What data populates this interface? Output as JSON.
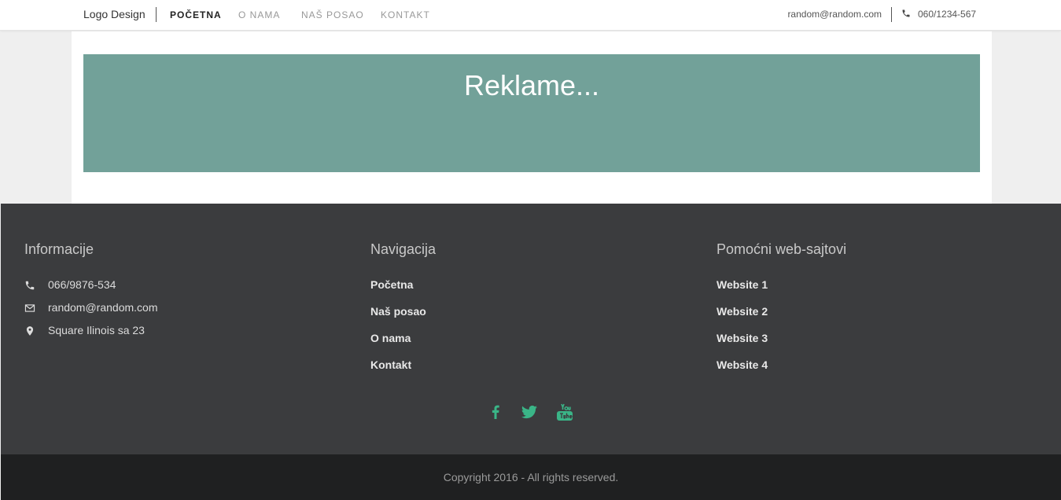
{
  "header": {
    "logo": "Logo Design",
    "nav": [
      {
        "label": "POČETNA"
      },
      {
        "label": "O NAMA"
      },
      {
        "label": "NAŠ POSAO"
      },
      {
        "label": "KONTAKT"
      }
    ],
    "email": "random@random.com",
    "phone": "060/1234-567"
  },
  "banner": {
    "title": "Reklame..."
  },
  "footer": {
    "info": {
      "title": "Informacije",
      "phone": "066/9876-534",
      "email": "random@random.com",
      "address": "Square Ilinois sa 23"
    },
    "navigation": {
      "title": "Navigacija",
      "links": [
        "Početna",
        "Naš posao",
        "O nama",
        "Kontakt"
      ]
    },
    "websites": {
      "title": "Pomoćni web-sajtovi",
      "links": [
        "Website 1",
        "Website 2",
        "Website 3",
        "Website 4"
      ]
    },
    "social": {
      "accent_color": "#3ab587",
      "icons": [
        "facebook-icon",
        "twitter-icon",
        "youtube-icon"
      ]
    },
    "copyright": "Copyright 2016 - All rights reserved."
  },
  "colors": {
    "banner": "#72a199",
    "footer": "#3b3c3e",
    "bottom_bar": "#1f2021"
  }
}
